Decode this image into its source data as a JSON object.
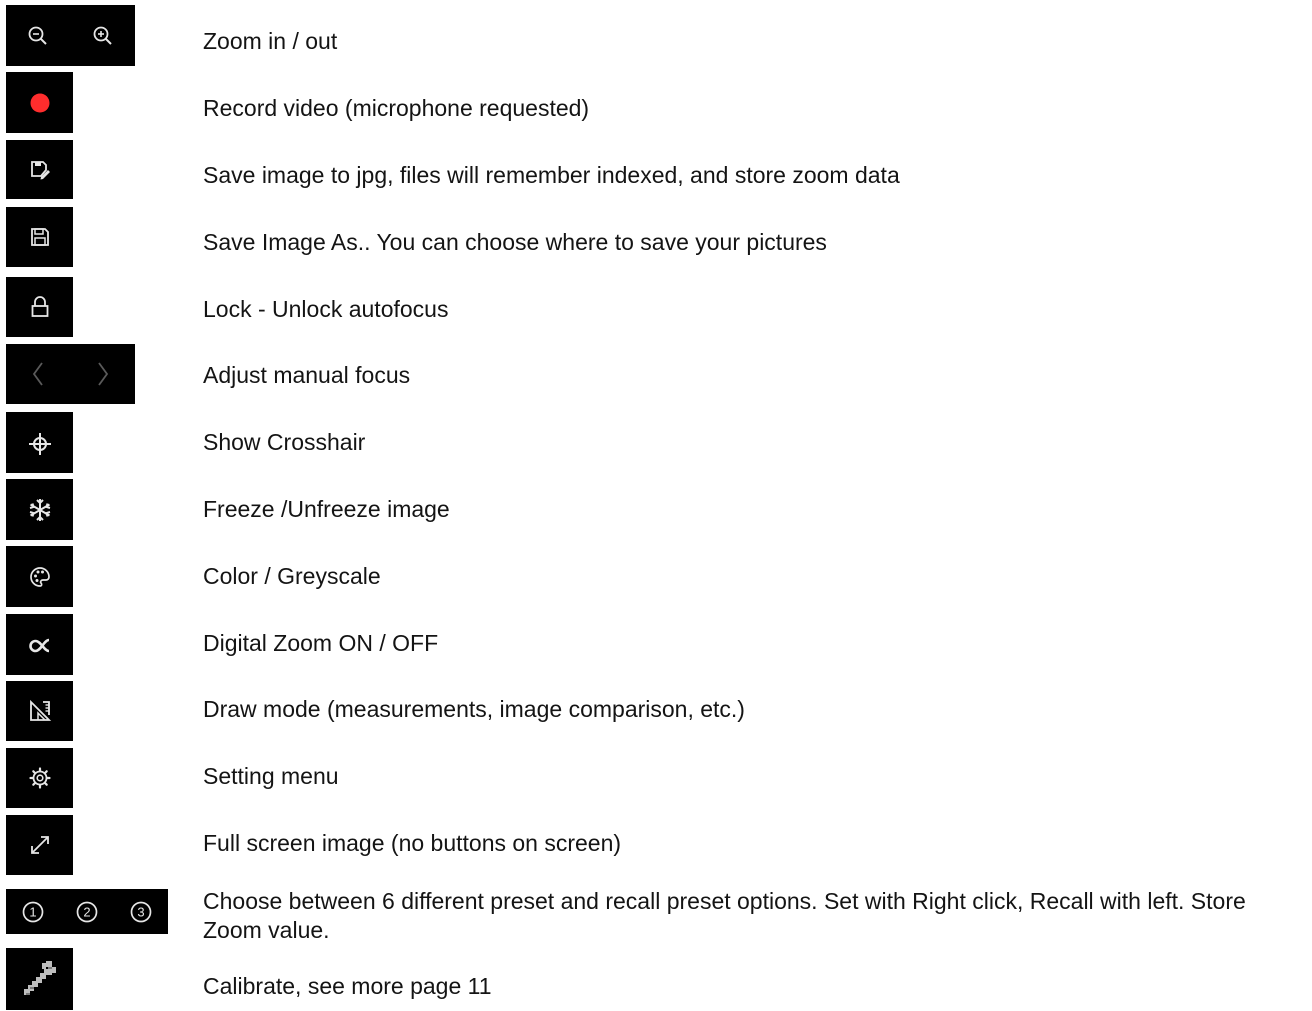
{
  "rows": [
    {
      "id": "zoom",
      "icons": [
        "zoom-out-icon",
        "zoom-in-icon"
      ],
      "text": "Zoom in / out"
    },
    {
      "id": "record",
      "icons": [
        "record-icon"
      ],
      "text": "Record video (microphone requested)"
    },
    {
      "id": "save",
      "icons": [
        "quick-save-icon"
      ],
      "text": "Save image to jpg, files will remember indexed, and store zoom data"
    },
    {
      "id": "save-as",
      "icons": [
        "save-as-icon"
      ],
      "text": "Save Image As.. You can choose where to save your pictures"
    },
    {
      "id": "lock",
      "icons": [
        "lock-icon"
      ],
      "text": "Lock - Unlock autofocus"
    },
    {
      "id": "focus",
      "icons": [
        "chevron-left-icon",
        "chevron-right-icon"
      ],
      "text": "Adjust manual focus"
    },
    {
      "id": "crosshair",
      "icons": [
        "crosshair-icon"
      ],
      "text": "Show Crosshair"
    },
    {
      "id": "freeze",
      "icons": [
        "snowflake-icon"
      ],
      "text": "Freeze /Unfreeze image"
    },
    {
      "id": "color",
      "icons": [
        "palette-icon"
      ],
      "text": "Color / Greyscale"
    },
    {
      "id": "digital-zoom",
      "icons": [
        "proportional-icon"
      ],
      "text": "Digital Zoom ON / OFF"
    },
    {
      "id": "draw",
      "icons": [
        "draw-mode-icon"
      ],
      "text": "Draw mode (measurements, image comparison, etc.)"
    },
    {
      "id": "settings",
      "icons": [
        "gear-icon"
      ],
      "text": "Setting menu"
    },
    {
      "id": "fullscreen",
      "icons": [
        "fullscreen-icon"
      ],
      "text": "Full screen image (no buttons on screen)"
    },
    {
      "id": "presets",
      "icons": [
        "preset-1-icon",
        "preset-2-icon",
        "preset-3-icon"
      ],
      "icon_labels": [
        "1",
        "2",
        "3"
      ],
      "text": "Choose between 6 different preset and recall preset options. Set with Right click, Recall with left. Store Zoom value."
    },
    {
      "id": "calibrate",
      "icons": [
        "wrench-icon"
      ],
      "text": "Calibrate, see more page 11"
    }
  ],
  "colors": {
    "button_bg": "#000000",
    "icon": "#e6e6e6",
    "icon_dim": "#5a5a5a",
    "record": "#ff2d2d",
    "text": "#141414"
  }
}
